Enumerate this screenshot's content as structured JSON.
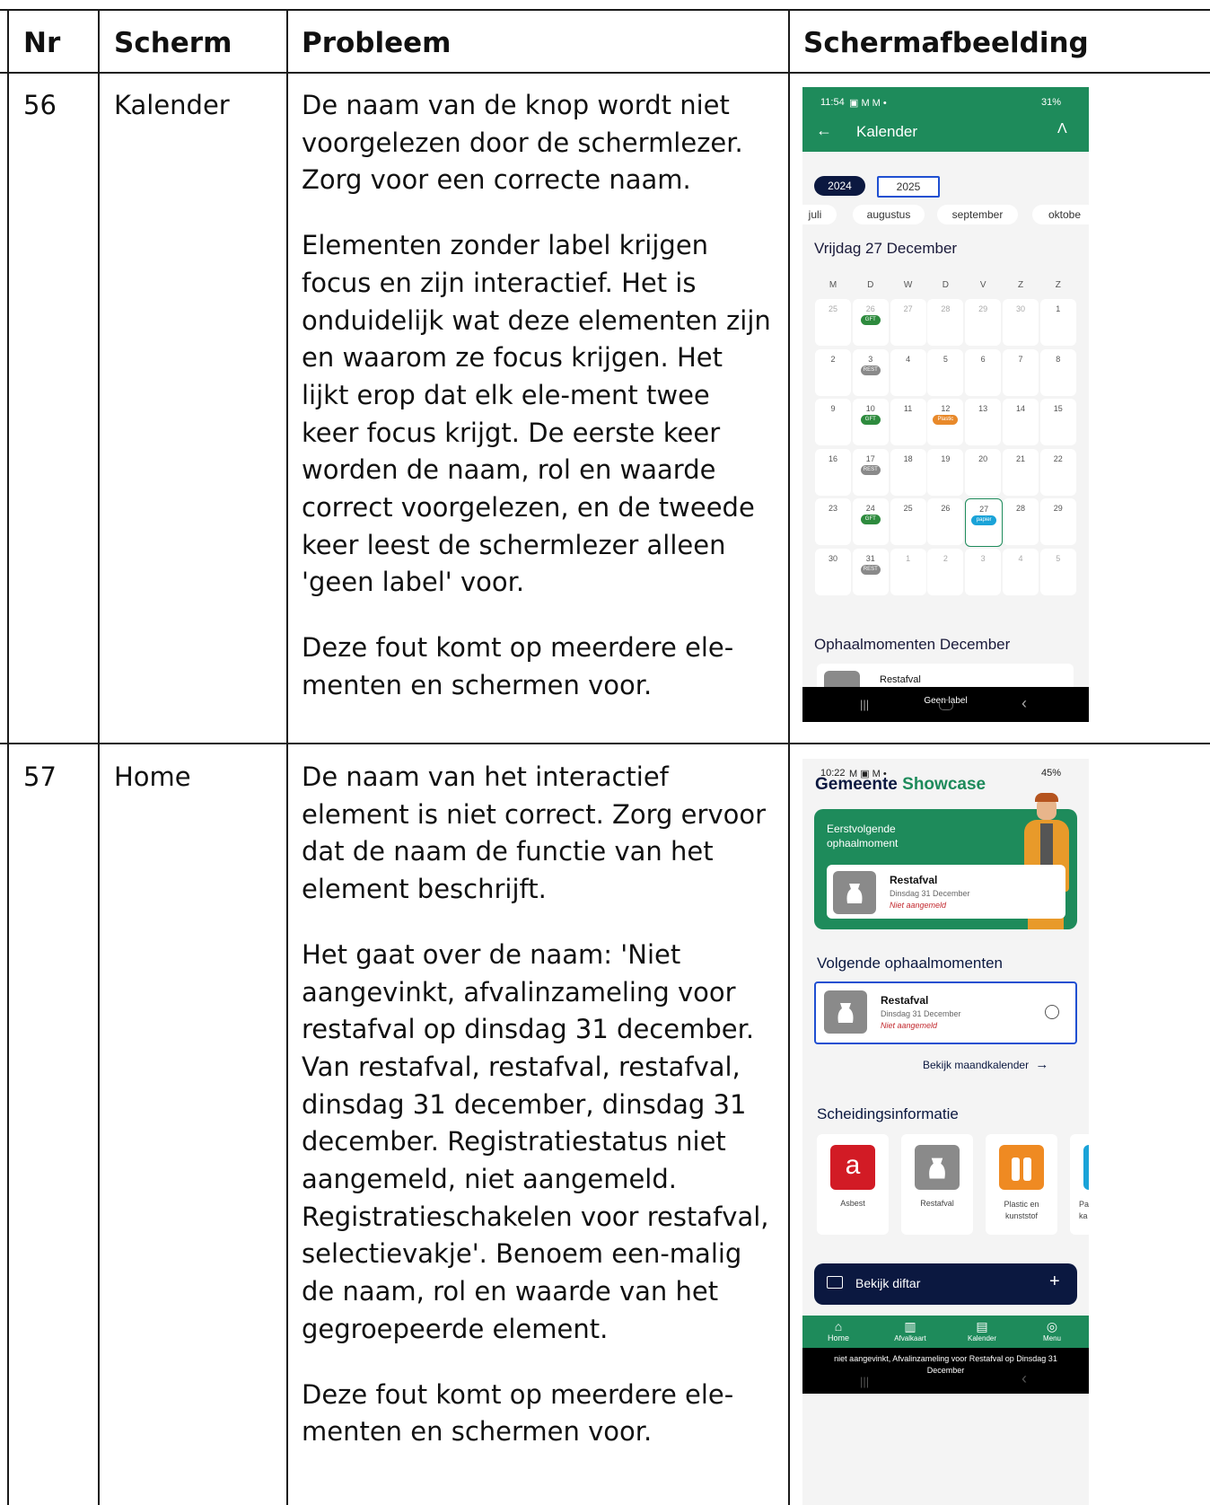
{
  "table": {
    "headers": [
      "Nr",
      "Scherm",
      "Probleem",
      "Schermafbeelding"
    ],
    "rows": [
      {
        "nr": "56",
        "scherm": "Kalender",
        "probleem": [
          "De naam van de knop wordt niet voorgelezen door de schermlezer. Zorg voor een correcte naam.",
          "Elementen zonder label krijgen focus en zijn interactief. Het is onduidelijk wat deze elementen zijn en waarom ze focus krijgen. Het lijkt erop dat elk ele-ment twee keer focus krijgt. De eerste keer worden de naam, rol en waarde correct voorgelezen, en de tweede keer leest de schermlezer alleen 'geen label' voor.",
          "Deze fout komt op meerdere ele-menten en schermen voor."
        ]
      },
      {
        "nr": "57",
        "scherm": "Home",
        "probleem": [
          "De naam van het interactief element is niet correct. Zorg ervoor dat de naam de functie van het element beschrijft.",
          "Het gaat over de naam: 'Niet aangevinkt, afvalinzameling voor restafval op dinsdag 31 december. Van restafval, restafval, restafval, dinsdag 31 december, dinsdag 31 december. Registratiestatus niet aangemeld, niet aangemeld. Registratieschakelen voor restafval, selectievakje'. Benoem een-malig de naam, rol en waarde van het gegroepeerde element.",
          "Deze fout komt op meerdere ele-menten en schermen voor."
        ]
      }
    ]
  },
  "screen1": {
    "time": "11:54",
    "status_icons": "▣ M M •",
    "battery": "31%",
    "title": "Kalender",
    "years": [
      "2024",
      "2025"
    ],
    "months": [
      "juli",
      "augustus",
      "september",
      "oktobe"
    ],
    "date_heading": "Vrijdag 27 December",
    "weekdays": [
      "M",
      "D",
      "W",
      "D",
      "V",
      "Z",
      "Z"
    ],
    "weeks": [
      [
        {
          "d": "25",
          "dim": true
        },
        {
          "d": "26",
          "dim": true,
          "tag": "GFT"
        },
        {
          "d": "27",
          "dim": true
        },
        {
          "d": "28",
          "dim": true
        },
        {
          "d": "29",
          "dim": true
        },
        {
          "d": "30",
          "dim": true
        },
        {
          "d": "1"
        }
      ],
      [
        {
          "d": "2"
        },
        {
          "d": "3",
          "tag": "REST"
        },
        {
          "d": "4"
        },
        {
          "d": "5"
        },
        {
          "d": "6"
        },
        {
          "d": "7"
        },
        {
          "d": "8"
        }
      ],
      [
        {
          "d": "9"
        },
        {
          "d": "10",
          "tag": "GFT"
        },
        {
          "d": "11"
        },
        {
          "d": "12",
          "tag": "Plastic"
        },
        {
          "d": "13"
        },
        {
          "d": "14"
        },
        {
          "d": "15"
        }
      ],
      [
        {
          "d": "16"
        },
        {
          "d": "17",
          "tag": "REST"
        },
        {
          "d": "18"
        },
        {
          "d": "19"
        },
        {
          "d": "20"
        },
        {
          "d": "21"
        },
        {
          "d": "22"
        }
      ],
      [
        {
          "d": "23"
        },
        {
          "d": "24",
          "tag": "GFT"
        },
        {
          "d": "25"
        },
        {
          "d": "26"
        },
        {
          "d": "27",
          "tag": "papier",
          "selected": true
        },
        {
          "d": "28"
        },
        {
          "d": "29"
        }
      ],
      [
        {
          "d": "30"
        },
        {
          "d": "31",
          "tag": "REST"
        },
        {
          "d": "1",
          "dim": true
        },
        {
          "d": "2",
          "dim": true
        },
        {
          "d": "3",
          "dim": true
        },
        {
          "d": "4",
          "dim": true
        },
        {
          "d": "5",
          "dim": true
        }
      ]
    ],
    "tag_colors": {
      "GFT": "#2e8b3e",
      "REST": "#8a8a8a",
      "Plastic": "#e8892a",
      "papier": "#1aa3d8"
    },
    "section": "Ophaalmomenten December",
    "card": "Restafval",
    "talkback": "Geen label"
  },
  "screen2": {
    "time": "10:22",
    "status_icons": "M ▣ M •",
    "battery": "45%",
    "brand1": "Gemeente",
    "brand2": "Showcase",
    "hero_label": "Eerstvolgende ophaalmoment",
    "hero_card": {
      "title": "Restafval",
      "date": "Dinsdag 31 December",
      "status": "Niet aangemeld"
    },
    "next_heading": "Volgende ophaalmomenten",
    "next_card": {
      "title": "Restafval",
      "date": "Dinsdag 31 December",
      "status": "Niet aangemeld"
    },
    "month_link": "Bekijk maandkalender",
    "sep_heading": "Scheidingsinformatie",
    "sep_items": [
      "Asbest",
      "Restafval",
      "Plastic en kunststof",
      "Pa ka"
    ],
    "diftar": "Bekijk diftar",
    "nav": [
      "Home",
      "Afvalkaart",
      "Kalender",
      "Menu"
    ],
    "talkback": "niet aangevinkt, Afvalinzameling voor Restafval op Dinsdag 31 December"
  }
}
